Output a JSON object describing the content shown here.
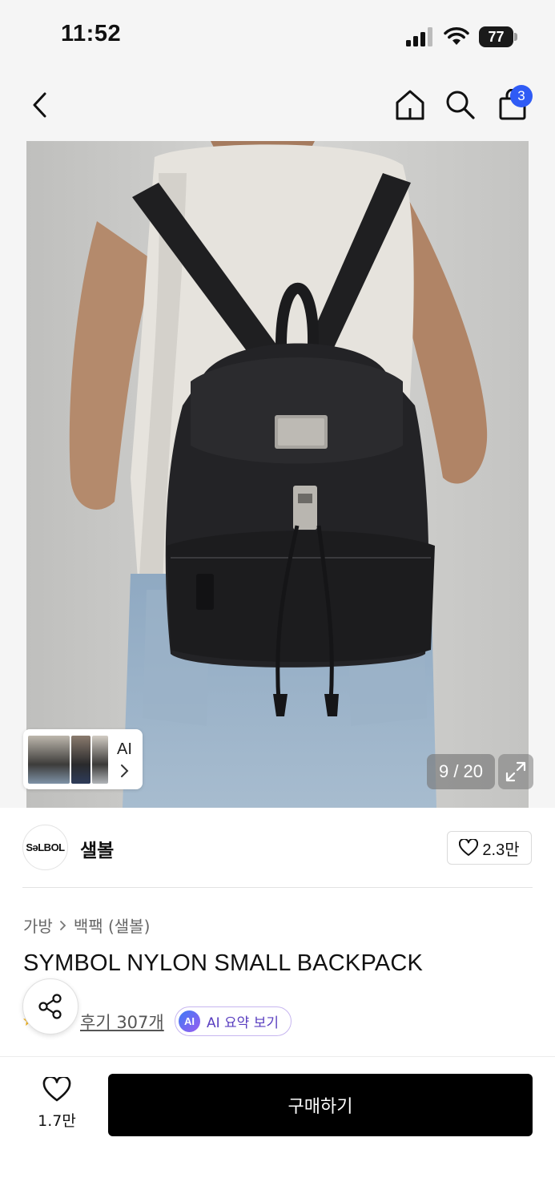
{
  "status_bar": {
    "time": "11:52",
    "battery": "77"
  },
  "nav": {
    "cart_badge": "3"
  },
  "gallery": {
    "ai_label": "AI",
    "counter": "9 / 20"
  },
  "brand": {
    "logo_text": "SəLBOL",
    "name": "샐볼",
    "favorite_count": "2.3만"
  },
  "breadcrumb": [
    "가방",
    "백팩 (샐볼)"
  ],
  "product": {
    "title": "SYMBOL NYLON SMALL BACKPACK",
    "review_link": "후기 307개",
    "ai_summary_badge": "AI",
    "ai_summary_label": "AI 요약 보기"
  },
  "bottom_bar": {
    "like_count": "1.7만",
    "buy_label": "구매하기"
  },
  "colors": {
    "accent_blue": "#2f5bf5",
    "buy_button": "#000000",
    "ai_purple": "#5a3fc0"
  },
  "icons": [
    "back-icon",
    "home-icon",
    "search-icon",
    "bag-icon",
    "chevron-right-icon",
    "expand-icon",
    "heart-icon",
    "share-icon",
    "star-icon"
  ]
}
